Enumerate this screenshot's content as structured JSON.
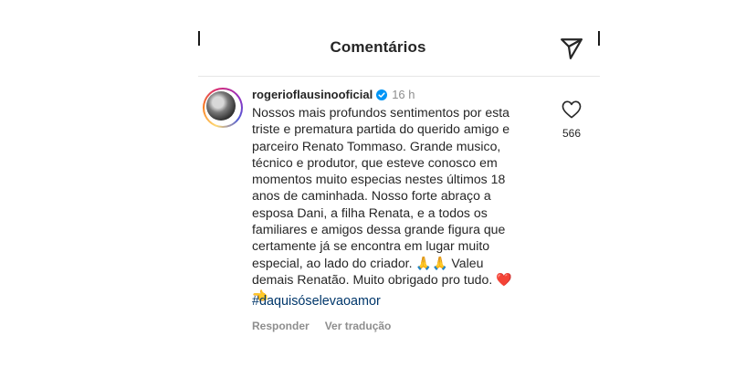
{
  "header": {
    "title": "Comentários"
  },
  "comment": {
    "username": "rogerioflausinooficial",
    "time": "16 h",
    "lines": [
      "Nossos mais profundos sentimentos por esta",
      "triste e prematura partida do querido amigo e",
      "parceiro Renato Tommaso. Grande musico,",
      "técnico e produtor, que esteve conosco em",
      "momentos muito especias nestes últimos 18",
      "anos de caminhada. Nosso forte abraço a",
      "esposa Dani, a filha Renata, e a todos os",
      "familiares e amigos dessa grande figura que",
      "certamente já se encontra em lugar muito",
      "especial, ao lado do criador. 🙏🙏 Valeu",
      "demais Renatão. Muito obrigado pro tudo. ❤️",
      "👈"
    ],
    "hashtag": "#daquisóselevaoamor",
    "reply_label": "Responder",
    "translate_label": "Ver tradução",
    "like_count": "566"
  },
  "colors": {
    "verified": "#0095f6",
    "hashtag": "#00376b",
    "muted": "#8e8e8e"
  },
  "icons": {
    "send": "paper-plane-icon",
    "like": "heart-outline-icon",
    "verified": "verified-badge-icon"
  }
}
